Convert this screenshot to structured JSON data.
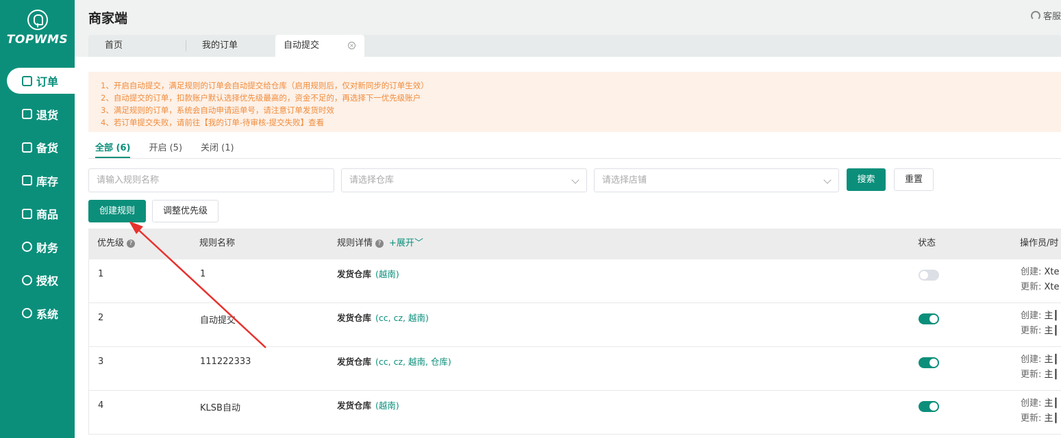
{
  "app": {
    "logo_text": "TOPWMS",
    "title": "商家端",
    "service_label": "客服"
  },
  "sidebar": {
    "items": [
      {
        "label": "订单",
        "icon": "document-icon",
        "active": true
      },
      {
        "label": "退货",
        "icon": "return-box-icon",
        "active": false
      },
      {
        "label": "备货",
        "icon": "stock-icon",
        "active": false
      },
      {
        "label": "库存",
        "icon": "inventory-icon",
        "active": false
      },
      {
        "label": "商品",
        "icon": "bag-icon",
        "active": false
      },
      {
        "label": "财务",
        "icon": "finance-icon",
        "active": false
      },
      {
        "label": "授权",
        "icon": "authorize-icon",
        "active": false
      },
      {
        "label": "系统",
        "icon": "gear-icon",
        "active": false
      }
    ]
  },
  "tabs": [
    {
      "label": "首页"
    },
    {
      "label": "我的订单"
    },
    {
      "label": "自动提交",
      "active": true,
      "closable": true
    }
  ],
  "notice": {
    "lines": [
      "1、开启自动提交，满足规则的订单会自动提交给仓库（启用规则后，仅对新同步的订单生效）",
      "2、自动提交的订单，扣款账户默认选择优先级最高的，资金不足的，再选择下一优先级账户",
      "3、满足规则的订单，系统会自动申请运单号，请注意订单发货时效",
      "4、若订单提交失败，请前往【我的订单-待审核-提交失败】查看"
    ]
  },
  "filter_tabs": [
    {
      "label": "全部 (6)",
      "active": true
    },
    {
      "label": "开启 (5)",
      "active": false
    },
    {
      "label": "关闭 (1)",
      "active": false
    }
  ],
  "search": {
    "rule_name_placeholder": "请输入规则名称",
    "warehouse_placeholder": "请选择仓库",
    "shop_placeholder": "请选择店铺",
    "search_label": "搜索",
    "reset_label": "重置"
  },
  "actions": {
    "create_label": "创建规则",
    "priority_label": "调整优先级"
  },
  "table": {
    "headers": {
      "priority": "优先级",
      "name": "规则名称",
      "detail": "规则详情",
      "expand": "+展开",
      "status": "状态",
      "operator": "操作员/时"
    },
    "rows": [
      {
        "priority": "1",
        "name": "1",
        "detail_label": "发货仓库",
        "warehouses": "(越南)",
        "enabled": false,
        "created": "创建:",
        "created_by": "Xte",
        "updated": "更新:",
        "updated_by": "Xte"
      },
      {
        "priority": "2",
        "name": "自动提交",
        "detail_label": "发货仓库",
        "warehouses": "(cc, cz, 越南)",
        "enabled": true,
        "created": "创建:",
        "created_by": "主┃",
        "updated": "更新:",
        "updated_by": "主┃"
      },
      {
        "priority": "3",
        "name": "111222333",
        "detail_label": "发货仓库",
        "warehouses": "(cc, cz, 越南, 仓库)",
        "enabled": true,
        "created": "创建:",
        "created_by": "主┃",
        "updated": "更新:",
        "updated_by": "主┃"
      },
      {
        "priority": "4",
        "name": "KLSB自动",
        "detail_label": "发货仓库",
        "warehouses": "(越南)",
        "enabled": true,
        "created": "创建:",
        "created_by": "主┃",
        "updated": "更新:",
        "updated_by": "主┃"
      }
    ]
  },
  "colors": {
    "brand": "#0b8f7b",
    "notice_text": "#f08c3c",
    "notice_bg": "#fdf1e8",
    "annotation_arrow": "#e8322e"
  }
}
